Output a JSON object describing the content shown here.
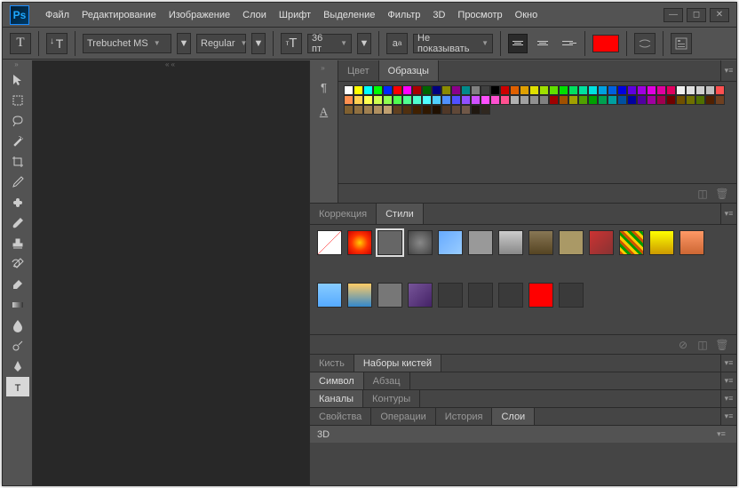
{
  "menu": [
    "Файл",
    "Редактирование",
    "Изображение",
    "Слои",
    "Шрифт",
    "Выделение",
    "Фильтр",
    "3D",
    "Просмотр",
    "Окно"
  ],
  "optbar": {
    "font": "Trebuchet MS",
    "weight": "Regular",
    "size": "36 пт",
    "aa": "Не показывать"
  },
  "text_color": "#ff0000",
  "panels": {
    "color_tabs": [
      "Цвет",
      "Образцы"
    ],
    "styles_tabs": [
      "Коррекция",
      "Стили"
    ],
    "brush_tabs": [
      "Кисть",
      "Наборы кистей"
    ],
    "para_tabs": [
      "Символ",
      "Абзац"
    ],
    "chan_tabs": [
      "Каналы",
      "Контуры"
    ],
    "layer_tabs": [
      "Свойства",
      "Операции",
      "История",
      "Слои"
    ],
    "label_3d": "3D"
  },
  "swatches": [
    "#ffffff",
    "#ffff00",
    "#00ffff",
    "#00ff00",
    "#0028ff",
    "#ff0000",
    "#ff00ff",
    "#a90000",
    "#006400",
    "#00007f",
    "#8b8b00",
    "#8b008b",
    "#008b8b",
    "#808080",
    "#404040",
    "#000000",
    "#cc0000",
    "#e06000",
    "#e0a000",
    "#e0e000",
    "#a0e000",
    "#60e000",
    "#00e000",
    "#00e060",
    "#00e0a0",
    "#00e0e0",
    "#00a0e0",
    "#0060e0",
    "#0000e0",
    "#6000e0",
    "#a000e0",
    "#e000e0",
    "#e000a0",
    "#e00060",
    "#f0f0f0",
    "#e0e0e0",
    "#d0d0d0",
    "#c0c0c0",
    "#ff5050",
    "#ff9050",
    "#ffd050",
    "#ffff50",
    "#d0ff50",
    "#90ff50",
    "#50ff50",
    "#50ff90",
    "#50ffd0",
    "#50ffff",
    "#50d0ff",
    "#5090ff",
    "#5050ff",
    "#9050ff",
    "#d050ff",
    "#ff50ff",
    "#ff50d0",
    "#ff5090",
    "#b0b0b0",
    "#a0a0a0",
    "#909090",
    "#808080",
    "#a00000",
    "#a05000",
    "#a0a000",
    "#50a000",
    "#00a000",
    "#00a050",
    "#00a0a0",
    "#0050a0",
    "#0000a0",
    "#5000a0",
    "#a000a0",
    "#a00050",
    "#700000",
    "#705000",
    "#707000",
    "#507000",
    "#502000",
    "#704020",
    "#806030",
    "#907040",
    "#a08050",
    "#b09060",
    "#c0a070",
    "#604020",
    "#503010",
    "#402000",
    "#301800",
    "#201000",
    "#503828",
    "#604838",
    "#705848",
    "#201810",
    "#302820"
  ],
  "styles": [
    {
      "bg": "linear-gradient(135deg,#fff 49%,#f00 50%,#fff 51%)"
    },
    {
      "bg": "radial-gradient(circle,#ffcc00,#ff3300,#cc0000)"
    },
    {
      "bg": "#666",
      "sel": true
    },
    {
      "bg": "radial-gradient(circle,#888,#444)"
    },
    {
      "bg": "linear-gradient(135deg,#6af,#9cf)"
    },
    {
      "bg": "#999"
    },
    {
      "bg": "linear-gradient(180deg,#ccc,#888)"
    },
    {
      "bg": "linear-gradient(180deg,#887755,#554422)"
    },
    {
      "bg": "#aa9966"
    },
    {
      "bg": "linear-gradient(135deg,#c33,#833)"
    },
    {
      "bg": "repeating-linear-gradient(45deg,#c50 0 3px,#fc0 3px 6px,#090 6px 9px)"
    },
    {
      "bg": "linear-gradient(180deg,#ff0,#c90)"
    },
    {
      "bg": "linear-gradient(180deg,#f96,#c63)"
    },
    {
      "bg": "linear-gradient(180deg,#8cf,#5af)"
    },
    {
      "bg": "linear-gradient(180deg,#fc6,#38c)"
    },
    {
      "bg": "#777"
    },
    {
      "bg": "linear-gradient(135deg,#759,#426)"
    },
    {
      "bg": "#3a3a3a"
    },
    {
      "bg": "#3a3a3a"
    },
    {
      "bg": "#3a3a3a"
    },
    {
      "bg": "#f00"
    },
    {
      "bg": "#3a3a3a"
    }
  ],
  "tools": [
    "move",
    "marquee",
    "lasso",
    "magic-wand",
    "crop",
    "eyedropper",
    "spot-heal",
    "brush",
    "stamp",
    "history-brush",
    "eraser",
    "gradient",
    "blur",
    "dodge",
    "pen",
    "type"
  ]
}
